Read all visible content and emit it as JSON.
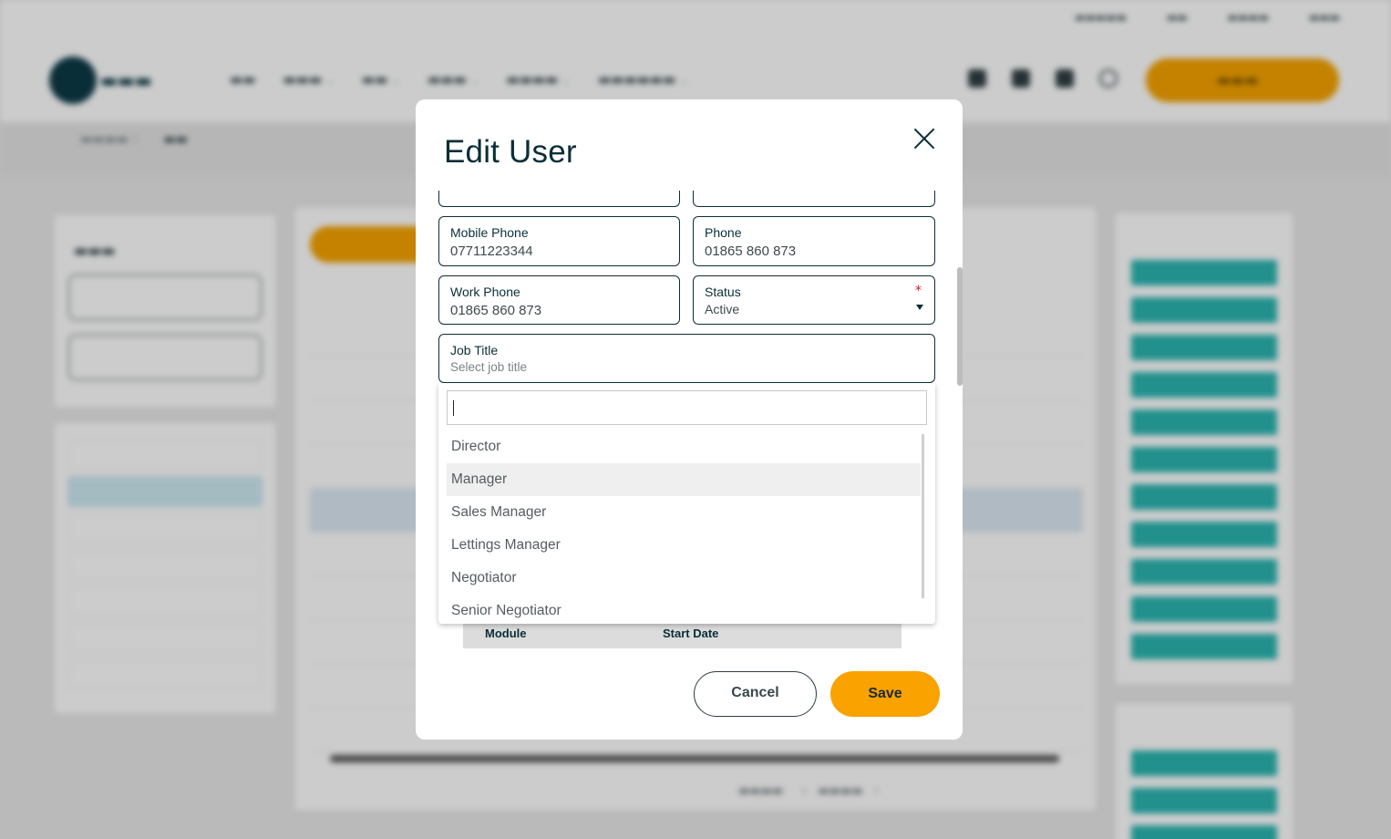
{
  "modal": {
    "title": "Edit User",
    "fields": {
      "mobile_phone": {
        "label": "Mobile Phone",
        "value": "07711223344"
      },
      "phone": {
        "label": "Phone",
        "value": "01865 860 873"
      },
      "work_phone": {
        "label": "Work Phone",
        "value": "01865 860 873"
      },
      "status": {
        "label": "Status",
        "value": "Active",
        "required_mark": "*"
      },
      "job_title": {
        "label": "Job Title",
        "placeholder": "Select job title"
      }
    },
    "job_title_dropdown": {
      "search_value": "",
      "options": [
        "Director",
        "Manager",
        "Sales Manager",
        "Lettings Manager",
        "Negotiator",
        "Senior Negotiator"
      ],
      "hovered": "Manager"
    },
    "module_table": {
      "columns": [
        "Module",
        "Start Date"
      ]
    },
    "buttons": {
      "cancel": "Cancel",
      "save": "Save"
    }
  },
  "colors": {
    "primary_dark": "#0c2e38",
    "accent": "#f9a200",
    "teal_chip": "#2bb5b0",
    "required": "#d0161d"
  }
}
